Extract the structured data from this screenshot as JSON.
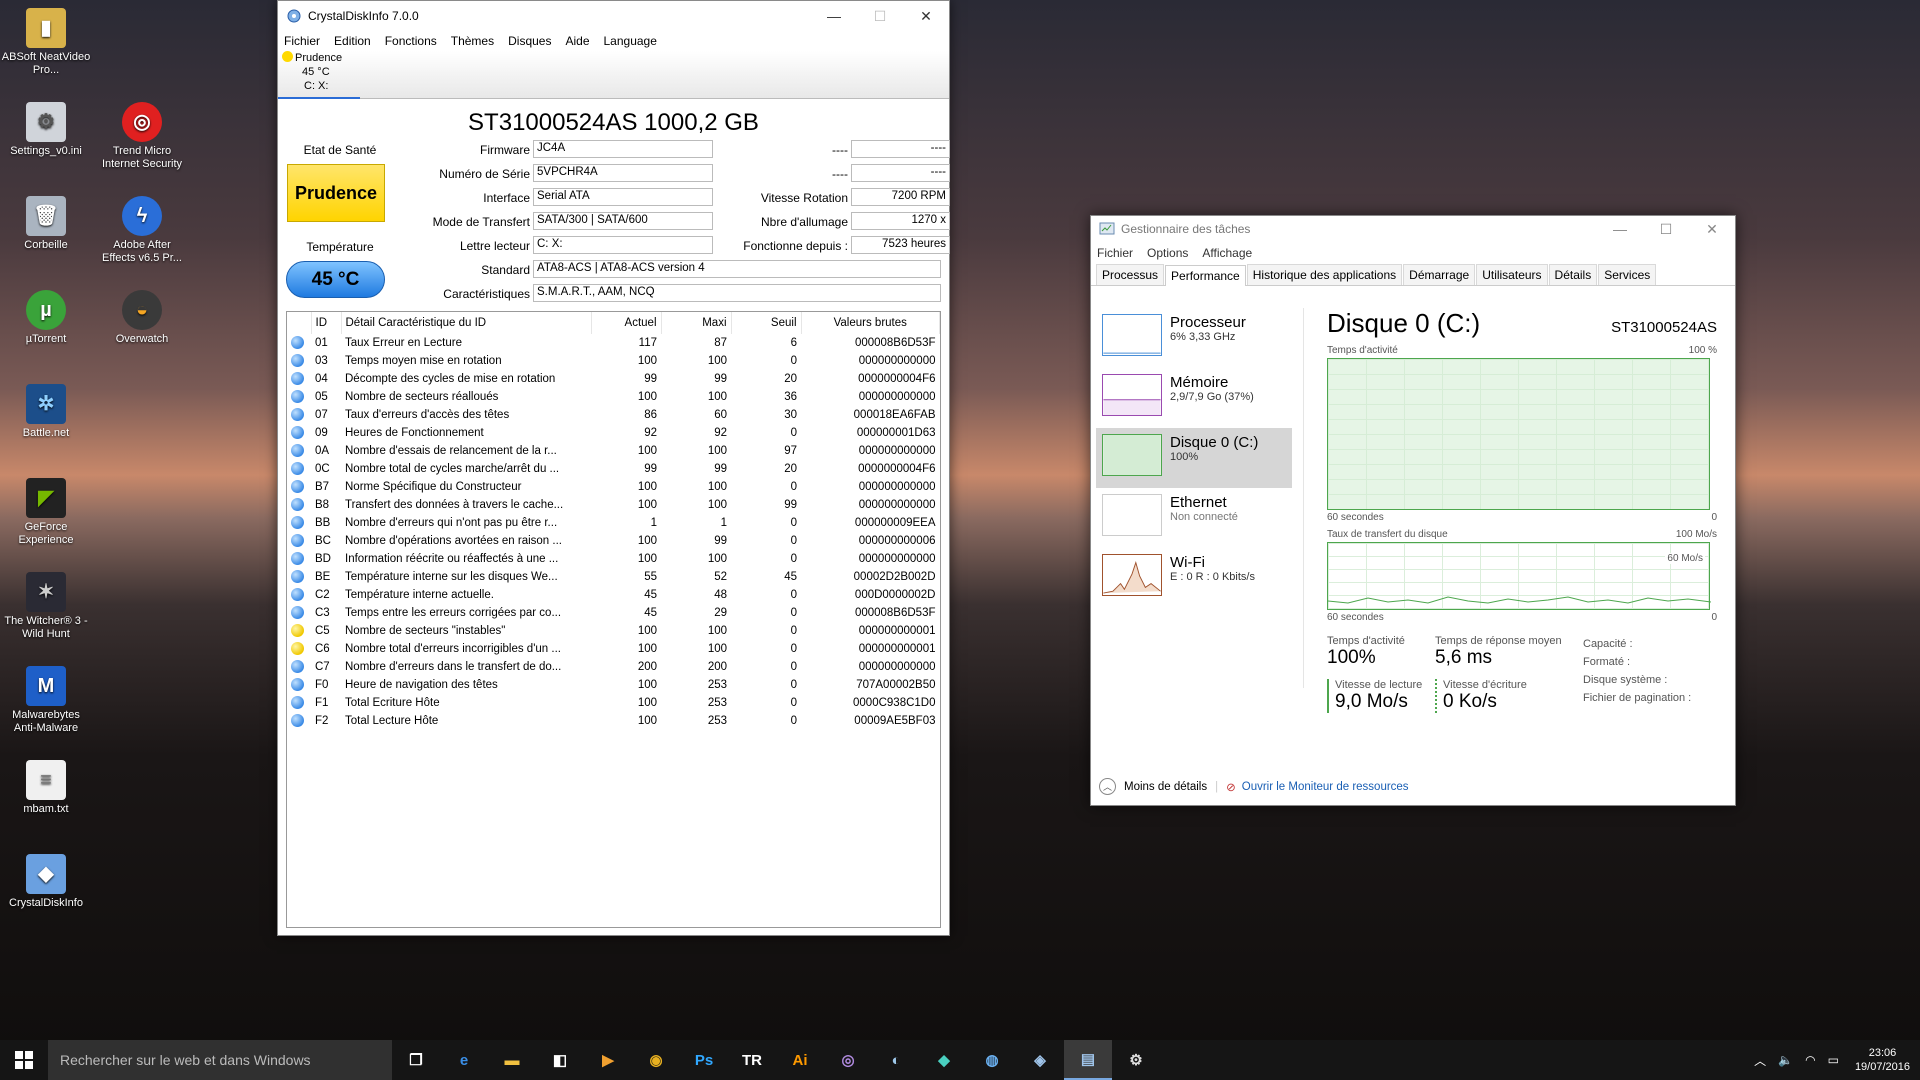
{
  "desktop": {
    "icons": [
      {
        "label": "ABSoft NeatVideo Pro..."
      },
      {
        "label": "Settings_v0.ini"
      },
      {
        "label": "Trend Micro Internet Security"
      },
      {
        "label": "Corbeille"
      },
      {
        "label": "Adobe After Effects v6.5 Pr..."
      },
      {
        "label": "µTorrent"
      },
      {
        "label": "Overwatch"
      },
      {
        "label": "Battle.net"
      },
      {
        "label": "GeForce Experience"
      },
      {
        "label": "The Witcher® 3 - Wild Hunt"
      },
      {
        "label": "Malwarebytes Anti-Malware"
      },
      {
        "label": "mbam.txt"
      },
      {
        "label": "CrystalDiskInfo"
      }
    ]
  },
  "cdi": {
    "title": "CrystalDiskInfo 7.0.0",
    "menu": [
      "Fichier",
      "Edition",
      "Fonctions",
      "Thèmes",
      "Disques",
      "Aide",
      "Language"
    ],
    "drive_tab": {
      "status": "Prudence",
      "temp": "45 °C",
      "letters": "C: X:"
    },
    "model": "ST31000524AS 1000,2 GB",
    "health_label": "Etat de Santé",
    "health": "Prudence",
    "temp_label": "Température",
    "temp": "45 °C",
    "fields": {
      "firmware_label": "Firmware",
      "firmware": "JC4A",
      "serial_label": "Numéro de Série",
      "serial": "5VPCHR4A",
      "interface_label": "Interface",
      "interface": "Serial ATA",
      "transfer_label": "Mode de Transfert",
      "transfer": "SATA/300 | SATA/600",
      "letters_label": "Lettre lecteur",
      "letters": "C: X:",
      "standard_label": "Standard",
      "standard": "ATA8-ACS | ATA8-ACS version 4",
      "features_label": "Caractéristiques",
      "features": "S.M.A.R.T., AAM, NCQ",
      "r1_label": "----",
      "r1": "----",
      "r2_label": "----",
      "r2": "----",
      "rotation_label": "Vitesse Rotation",
      "rotation": "7200 RPM",
      "power_count_label": "Nbre d'allumage",
      "power_count": "1270 x",
      "power_hours_label": "Fonctionne depuis :",
      "power_hours": "7523 heures"
    },
    "smart_headers": [
      "ID",
      "Détail Caractéristique du ID",
      "Actuel",
      "Maxi",
      "Seuil",
      "Valeurs brutes"
    ],
    "smart_rows": [
      {
        "status": "ok",
        "id": "01",
        "name": "Taux Erreur en Lecture",
        "cur": "117",
        "max": "87",
        "thr": "6",
        "raw": "000008B6D53F"
      },
      {
        "status": "ok",
        "id": "03",
        "name": "Temps moyen mise en rotation",
        "cur": "100",
        "max": "100",
        "thr": "0",
        "raw": "000000000000"
      },
      {
        "status": "ok",
        "id": "04",
        "name": "Décompte des cycles de mise en rotation",
        "cur": "99",
        "max": "99",
        "thr": "20",
        "raw": "0000000004F6"
      },
      {
        "status": "ok",
        "id": "05",
        "name": "Nombre de secteurs réalloués",
        "cur": "100",
        "max": "100",
        "thr": "36",
        "raw": "000000000000"
      },
      {
        "status": "ok",
        "id": "07",
        "name": "Taux d'erreurs d'accès des têtes",
        "cur": "86",
        "max": "60",
        "thr": "30",
        "raw": "000018EA6FAB"
      },
      {
        "status": "ok",
        "id": "09",
        "name": "Heures de Fonctionnement",
        "cur": "92",
        "max": "92",
        "thr": "0",
        "raw": "000000001D63"
      },
      {
        "status": "ok",
        "id": "0A",
        "name": "Nombre d'essais de relancement de la r...",
        "cur": "100",
        "max": "100",
        "thr": "97",
        "raw": "000000000000"
      },
      {
        "status": "ok",
        "id": "0C",
        "name": "Nombre total de cycles marche/arrêt du ...",
        "cur": "99",
        "max": "99",
        "thr": "20",
        "raw": "0000000004F6"
      },
      {
        "status": "ok",
        "id": "B7",
        "name": "Norme Spécifique du Constructeur",
        "cur": "100",
        "max": "100",
        "thr": "0",
        "raw": "000000000000"
      },
      {
        "status": "ok",
        "id": "B8",
        "name": "Transfert des données à travers le cache...",
        "cur": "100",
        "max": "100",
        "thr": "99",
        "raw": "000000000000"
      },
      {
        "status": "ok",
        "id": "BB",
        "name": "Nombre d'erreurs qui n'ont pas pu être r...",
        "cur": "1",
        "max": "1",
        "thr": "0",
        "raw": "000000009EEA"
      },
      {
        "status": "ok",
        "id": "BC",
        "name": "Nombre d'opérations avortées en raison ...",
        "cur": "100",
        "max": "99",
        "thr": "0",
        "raw": "000000000006"
      },
      {
        "status": "ok",
        "id": "BD",
        "name": "Information réécrite ou réaffectés à une ...",
        "cur": "100",
        "max": "100",
        "thr": "0",
        "raw": "000000000000"
      },
      {
        "status": "ok",
        "id": "BE",
        "name": "Température interne sur les disques We...",
        "cur": "55",
        "max": "52",
        "thr": "45",
        "raw": "00002D2B002D"
      },
      {
        "status": "ok",
        "id": "C2",
        "name": "Température interne actuelle.",
        "cur": "45",
        "max": "48",
        "thr": "0",
        "raw": "000D0000002D"
      },
      {
        "status": "ok",
        "id": "C3",
        "name": "Temps entre les erreurs corrigées par co...",
        "cur": "45",
        "max": "29",
        "thr": "0",
        "raw": "000008B6D53F"
      },
      {
        "status": "warn",
        "id": "C5",
        "name": "Nombre de secteurs \"instables\"",
        "cur": "100",
        "max": "100",
        "thr": "0",
        "raw": "000000000001"
      },
      {
        "status": "warn",
        "id": "C6",
        "name": "Nombre total d'erreurs incorrigibles d'un ...",
        "cur": "100",
        "max": "100",
        "thr": "0",
        "raw": "000000000001"
      },
      {
        "status": "ok",
        "id": "C7",
        "name": "Nombre d'erreurs dans le transfert de do...",
        "cur": "200",
        "max": "200",
        "thr": "0",
        "raw": "000000000000"
      },
      {
        "status": "ok",
        "id": "F0",
        "name": "Heure de navigation des têtes",
        "cur": "100",
        "max": "253",
        "thr": "0",
        "raw": "707A00002B50"
      },
      {
        "status": "ok",
        "id": "F1",
        "name": "Total Ecriture Hôte",
        "cur": "100",
        "max": "253",
        "thr": "0",
        "raw": "0000C938C1D0"
      },
      {
        "status": "ok",
        "id": "F2",
        "name": "Total Lecture Hôte",
        "cur": "100",
        "max": "253",
        "thr": "0",
        "raw": "00009AE5BF03"
      }
    ]
  },
  "tm": {
    "title": "Gestionnaire des tâches",
    "menu": [
      "Fichier",
      "Options",
      "Affichage"
    ],
    "tabs": [
      "Processus",
      "Performance",
      "Historique des applications",
      "Démarrage",
      "Utilisateurs",
      "Détails",
      "Services"
    ],
    "resources": [
      {
        "name": "Processeur",
        "sub": "6% 3,33 GHz"
      },
      {
        "name": "Mémoire",
        "sub": "2,9/7,9 Go (37%)"
      },
      {
        "name": "Disque 0 (C:)",
        "sub": "100%"
      },
      {
        "name": "Ethernet",
        "sub": "Non connecté"
      },
      {
        "name": "Wi-Fi",
        "sub": "E : 0 R : 0 Kbits/s"
      }
    ],
    "detail": {
      "title": "Disque 0 (C:)",
      "model": "ST31000524AS",
      "g1_label": "Temps d'activité",
      "g1_max": "100 %",
      "g1_time": "60 secondes",
      "g1_min": "0",
      "g2_label": "Taux de transfert du disque",
      "g2_max": "100 Mo/s",
      "g2_scale": "60 Mo/s",
      "g2_time": "60 secondes",
      "g2_min": "0",
      "active_time_label": "Temps d'activité",
      "active_time": "100%",
      "response_label": "Temps de réponse moyen",
      "response": "5,6 ms",
      "read_label": "Vitesse de lecture",
      "read": "9,0 Mo/s",
      "write_label": "Vitesse d'écriture",
      "write": "0 Ko/s",
      "capacity_label": "Capacité :",
      "formatted_label": "Formaté :",
      "system_label": "Disque système :",
      "pagefile_label": "Fichier de pagination :"
    },
    "less_details": "Moins de détails",
    "resource_monitor": "Ouvrir le Moniteur de ressources"
  },
  "taskbar": {
    "search_placeholder": "Rechercher sur le web et dans Windows",
    "time": "23:06",
    "date": "19/07/2016"
  }
}
